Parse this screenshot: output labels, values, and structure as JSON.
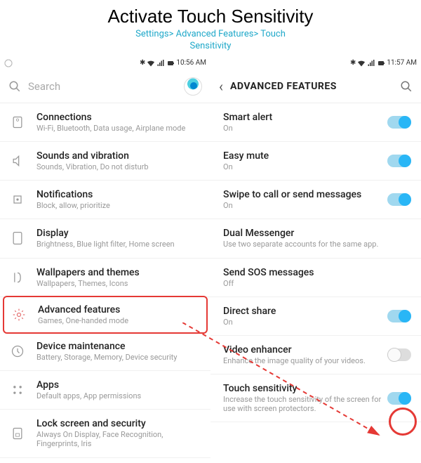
{
  "header": {
    "title": "Activate Touch Sensitivity",
    "breadcrumb1": "Settings> Advanced Features> Touch",
    "breadcrumb2": "Sensitivity"
  },
  "left": {
    "statusTime": "10:56 AM",
    "searchPlaceholder": "Search",
    "items": [
      {
        "label": "Connections",
        "sub": "Wi-Fi, Bluetooth, Data usage, Airplane mode",
        "icon": "connections"
      },
      {
        "label": "Sounds and vibration",
        "sub": "Sounds, Vibration, Do not disturb",
        "icon": "sound"
      },
      {
        "label": "Notifications",
        "sub": "Block, allow, prioritize",
        "icon": "notifications"
      },
      {
        "label": "Display",
        "sub": "Brightness, Blue light filter, Home screen",
        "icon": "display"
      },
      {
        "label": "Wallpapers and themes",
        "sub": "Wallpapers, Themes, Icons",
        "icon": "wallpaper"
      },
      {
        "label": "Advanced features",
        "sub": "Games, One-handed mode",
        "icon": "advanced",
        "highlight": true
      },
      {
        "label": "Device maintenance",
        "sub": "Battery, Storage, Memory, Device security",
        "icon": "device"
      },
      {
        "label": "Apps",
        "sub": "Default apps, App permissions",
        "icon": "apps"
      },
      {
        "label": "Lock screen and security",
        "sub": "Always On Display, Face Recognition, Fingerprints, Iris",
        "icon": "lockscreen"
      }
    ]
  },
  "right": {
    "statusTime": "11:57 AM",
    "title": "ADVANCED FEATURES",
    "items": [
      {
        "label": "Smart alert",
        "sub": "On",
        "toggle": "on"
      },
      {
        "label": "Easy mute",
        "sub": "On",
        "toggle": "on"
      },
      {
        "label": "Swipe to call or send messages",
        "sub": "On",
        "toggle": "on"
      },
      {
        "label": "Dual Messenger",
        "sub": "Use two separate accounts for the same app."
      },
      {
        "label": "Send SOS messages",
        "sub": "Off"
      },
      {
        "label": "Direct share",
        "sub": "On",
        "toggle": "on"
      },
      {
        "label": "Video enhancer",
        "sub": "Enhance the image quality of your videos.",
        "toggle": "off"
      },
      {
        "label": "Touch sensitivity",
        "sub": "Increase the touch sensitivity of the screen for use with screen protectors.",
        "toggle": "on",
        "circled": true
      }
    ]
  }
}
